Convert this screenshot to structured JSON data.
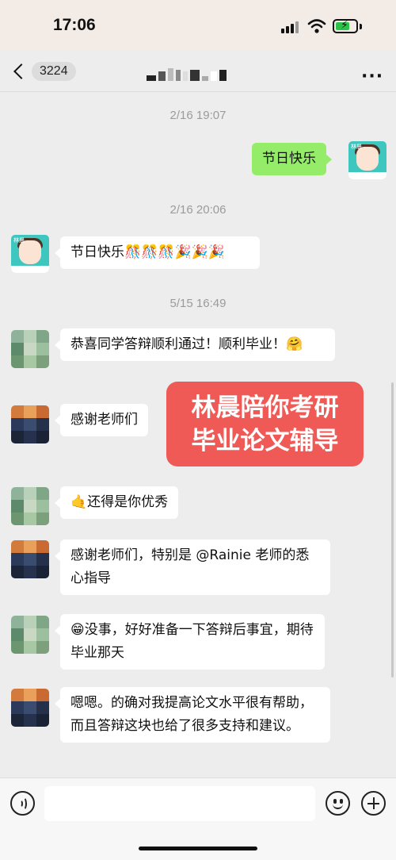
{
  "status_bar": {
    "time": "17:06",
    "battery_charging": true,
    "battery_level": 0.6,
    "icons": [
      "signal-icon",
      "wifi-icon",
      "battery-icon"
    ]
  },
  "nav": {
    "back_badge": "3224",
    "title": "",
    "more_icon": "more-icon"
  },
  "chat": {
    "timestamps": [
      "2/16 19:07",
      "2/16 20:06",
      "5/15 16:49"
    ],
    "messages": [
      {
        "side": "right",
        "sender": "teacher",
        "text": "节日快乐"
      },
      {
        "side": "left",
        "sender": "teacher",
        "text": "节日快乐🎊🎊🎊🎉🎉🎉"
      },
      {
        "side": "left",
        "sender": "student-b",
        "text": "恭喜同学答辩顺利通过！顺利毕业！🤗"
      },
      {
        "side": "left",
        "sender": "student",
        "text": "感谢老师们"
      },
      {
        "side": "left",
        "sender": "student-b",
        "text": "🤙还得是你优秀"
      },
      {
        "side": "left",
        "sender": "student",
        "text": "感谢老师们，特别是 @Rainie 老师的悉心指导"
      },
      {
        "side": "left",
        "sender": "student-b",
        "text": "😁没事，好好准备一下答辩后事宜，期待毕业那天"
      },
      {
        "side": "left",
        "sender": "student",
        "text": "嗯嗯。的确对我提高论文水平很有帮助，而且答辩这块也给了很多支持和建议。"
      }
    ],
    "avatar_tag": "林晨"
  },
  "promo": {
    "line1": "林晨陪你考研",
    "line2": "毕业论文辅导"
  },
  "composer": {
    "input_value": "",
    "icons": [
      "voice-icon",
      "mic-icon",
      "emoji-icon",
      "plus-icon"
    ]
  },
  "colors": {
    "sent_bubble": "#95ec69",
    "received_bubble": "#ffffff",
    "promo_bg": "#ef5a57",
    "chat_bg": "#ededed",
    "teacher_avatar": "#3fc7bf"
  }
}
